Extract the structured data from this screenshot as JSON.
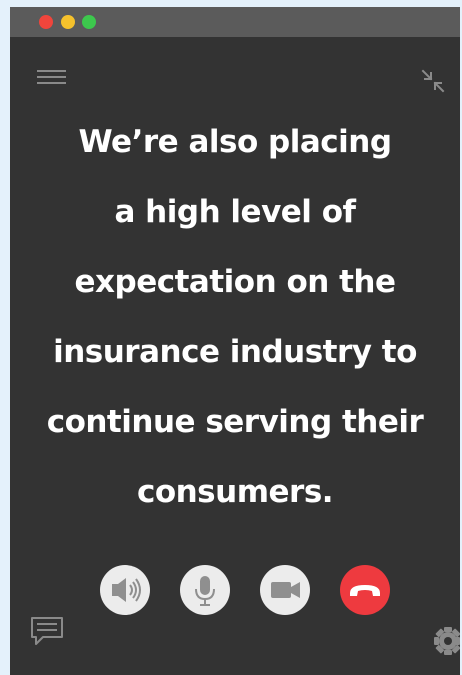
{
  "window": {
    "traffic_lights": [
      "close",
      "minimize",
      "zoom"
    ]
  },
  "caption": {
    "lines": [
      "We’re also placing",
      "a high level of",
      "expectation on the",
      "insurance industry to",
      "continue serving their",
      "consumers."
    ]
  },
  "controls": {
    "items": [
      {
        "name": "speaker",
        "icon": "speaker-icon"
      },
      {
        "name": "microphone",
        "icon": "microphone-icon"
      },
      {
        "name": "camera",
        "icon": "video-camera-icon"
      },
      {
        "name": "hang-up",
        "icon": "phone-hangup-icon"
      }
    ]
  },
  "icons": {
    "menu": "menu-icon",
    "collapse": "collapse-icon",
    "chat": "chat-icon",
    "settings": "gear-icon"
  },
  "colors": {
    "window_bg": "#333333",
    "titlebar_bg": "#5b5b5b",
    "page_bg": "#e4f1fb",
    "close": "#f0453c",
    "minimize": "#f5c12c",
    "zoom": "#3dc84d",
    "hangup": "#ee3a3f",
    "control_bg": "#ececec",
    "caption_text": "#ffffff"
  }
}
